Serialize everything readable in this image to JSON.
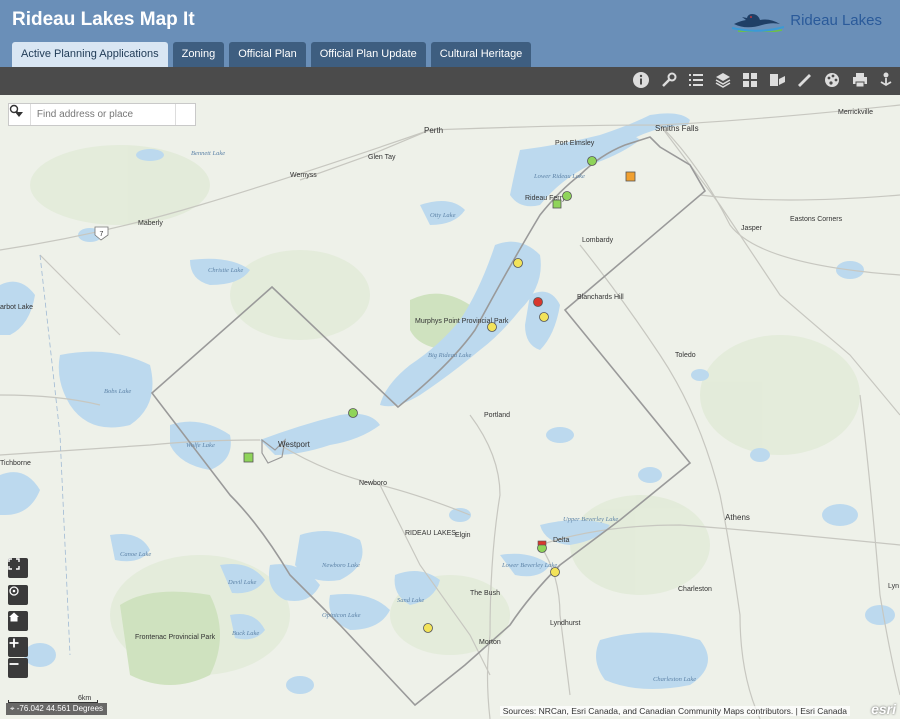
{
  "header": {
    "title": "Rideau Lakes Map It",
    "brand": "Rideau Lakes"
  },
  "tabs": [
    {
      "label": "Active Planning Applications",
      "active": true
    },
    {
      "label": "Zoning",
      "active": false
    },
    {
      "label": "Official Plan",
      "active": false
    },
    {
      "label": "Official Plan Update",
      "active": false
    },
    {
      "label": "Cultural Heritage",
      "active": false
    }
  ],
  "toolbar": {
    "tools": [
      "info-icon",
      "wrench-icon",
      "list-icon",
      "layers-icon",
      "basemap-grid-icon",
      "print-layout-icon",
      "measure-icon",
      "palette-icon",
      "print-icon",
      "share-icon"
    ]
  },
  "search": {
    "placeholder": "Find address or place"
  },
  "map": {
    "places": [
      "Perth",
      "Smiths Falls",
      "Merrickville",
      "Port Elmsley",
      "Glen Tay",
      "Wemyss",
      "Rideau Ferry",
      "Lombardy",
      "Maberly",
      "Jasper",
      "Eastons Corners",
      "Blanchards Hill",
      "Murphys Point Provincial Park",
      "Toledo",
      "Westport",
      "Portland",
      "Newboro",
      "Tichborne",
      "RIDEAU LAKES",
      "Elgin",
      "Delta",
      "Athens",
      "The Bush",
      "Charleston",
      "Lyndhurst",
      "Frontenac Provincial Park",
      "Morton",
      "arbot Lake",
      "Lyn"
    ],
    "lakes": [
      "Bennett Lake",
      "Lower Rideau Lake",
      "Otty Lake",
      "Christie Lake",
      "Big Rideau Lake",
      "Bobs Lake",
      "Wolfe Lake",
      "Upper Beverley Lake",
      "Lower Beverley Lake",
      "Canoe Lake",
      "Devil Lake",
      "Newboro Lake",
      "Sand Lake",
      "Opinicon Lake",
      "Buck Lake",
      "Charleston Lake"
    ],
    "route": "7",
    "applications": [
      {
        "status": "green",
        "shape": "circle"
      },
      {
        "status": "green",
        "shape": "circle"
      },
      {
        "status": "green",
        "shape": "square"
      },
      {
        "status": "orange",
        "shape": "square"
      },
      {
        "status": "yellow",
        "shape": "circle"
      },
      {
        "status": "red",
        "shape": "circle"
      },
      {
        "status": "yellow",
        "shape": "circle"
      },
      {
        "status": "yellow",
        "shape": "circle"
      },
      {
        "status": "green",
        "shape": "circle"
      },
      {
        "status": "green",
        "shape": "square"
      },
      {
        "status": "green",
        "shape": "circle"
      },
      {
        "status": "red",
        "shape": "square"
      },
      {
        "status": "yellow",
        "shape": "circle"
      },
      {
        "status": "yellow",
        "shape": "circle"
      }
    ],
    "status_colors": {
      "green": "#8fd45a",
      "yellow": "#f2e35a",
      "red": "#d8372d",
      "orange": "#f0a030"
    }
  },
  "scale": {
    "label": "6km"
  },
  "coords": "-76.042 44.561 Degrees",
  "attribution": "Sources: NRCan, Esri Canada, and Canadian Community Maps contributors. | Esri Canada",
  "esri_logo": "esri"
}
